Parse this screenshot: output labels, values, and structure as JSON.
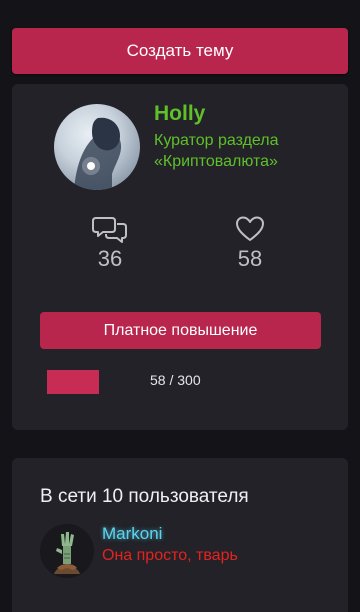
{
  "create_topic_label": "Создать тему",
  "profile": {
    "name": "Holly",
    "role": "Куратор раздела «Криптовалюта»",
    "stats": {
      "messages": "36",
      "likes": "58"
    },
    "promote_label": "Платное повышение",
    "progress": {
      "text": "58 / 300",
      "fraction": 0.193
    }
  },
  "online": {
    "title": "В сети 10 пользователя",
    "members": [
      {
        "name": "Markoni",
        "status": "Она просто, тварь"
      }
    ]
  },
  "colors": {
    "accent": "#b8264d",
    "name_green": "#5fc02a",
    "member_cyan": "#5ad6f0",
    "status_red": "#e5221f"
  }
}
